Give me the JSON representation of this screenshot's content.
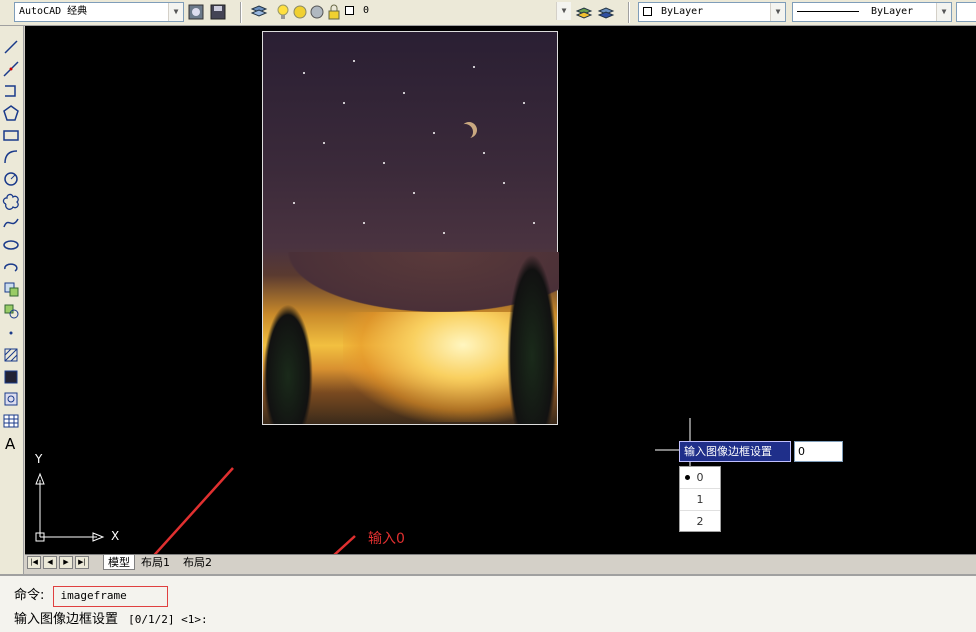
{
  "toolbar": {
    "workspace": "AutoCAD 经典",
    "layer_value": "0",
    "color_value": "ByLayer",
    "linetype_value": "ByLayer"
  },
  "layout_tabs": [
    "模型",
    "布局1",
    "布局2"
  ],
  "ucs": {
    "x_label": "X",
    "y_label": "Y"
  },
  "dynamic_prompt": {
    "label": "输入图像边框设置",
    "input_value": "0",
    "options": [
      "0",
      "1",
      "2"
    ],
    "selected_option": "0"
  },
  "command": {
    "prefix": "命令:",
    "entered": "imageframe",
    "prompt_text": "输入图像边框设置",
    "prompt_options": "[0/1/2] <1>:"
  },
  "annotation": {
    "text": "输入0",
    "color": "#e03030"
  },
  "colors": {
    "canvas_bg": "#000000",
    "tooltip_bg": "#1f2f8a",
    "annotation": "#e03030"
  }
}
